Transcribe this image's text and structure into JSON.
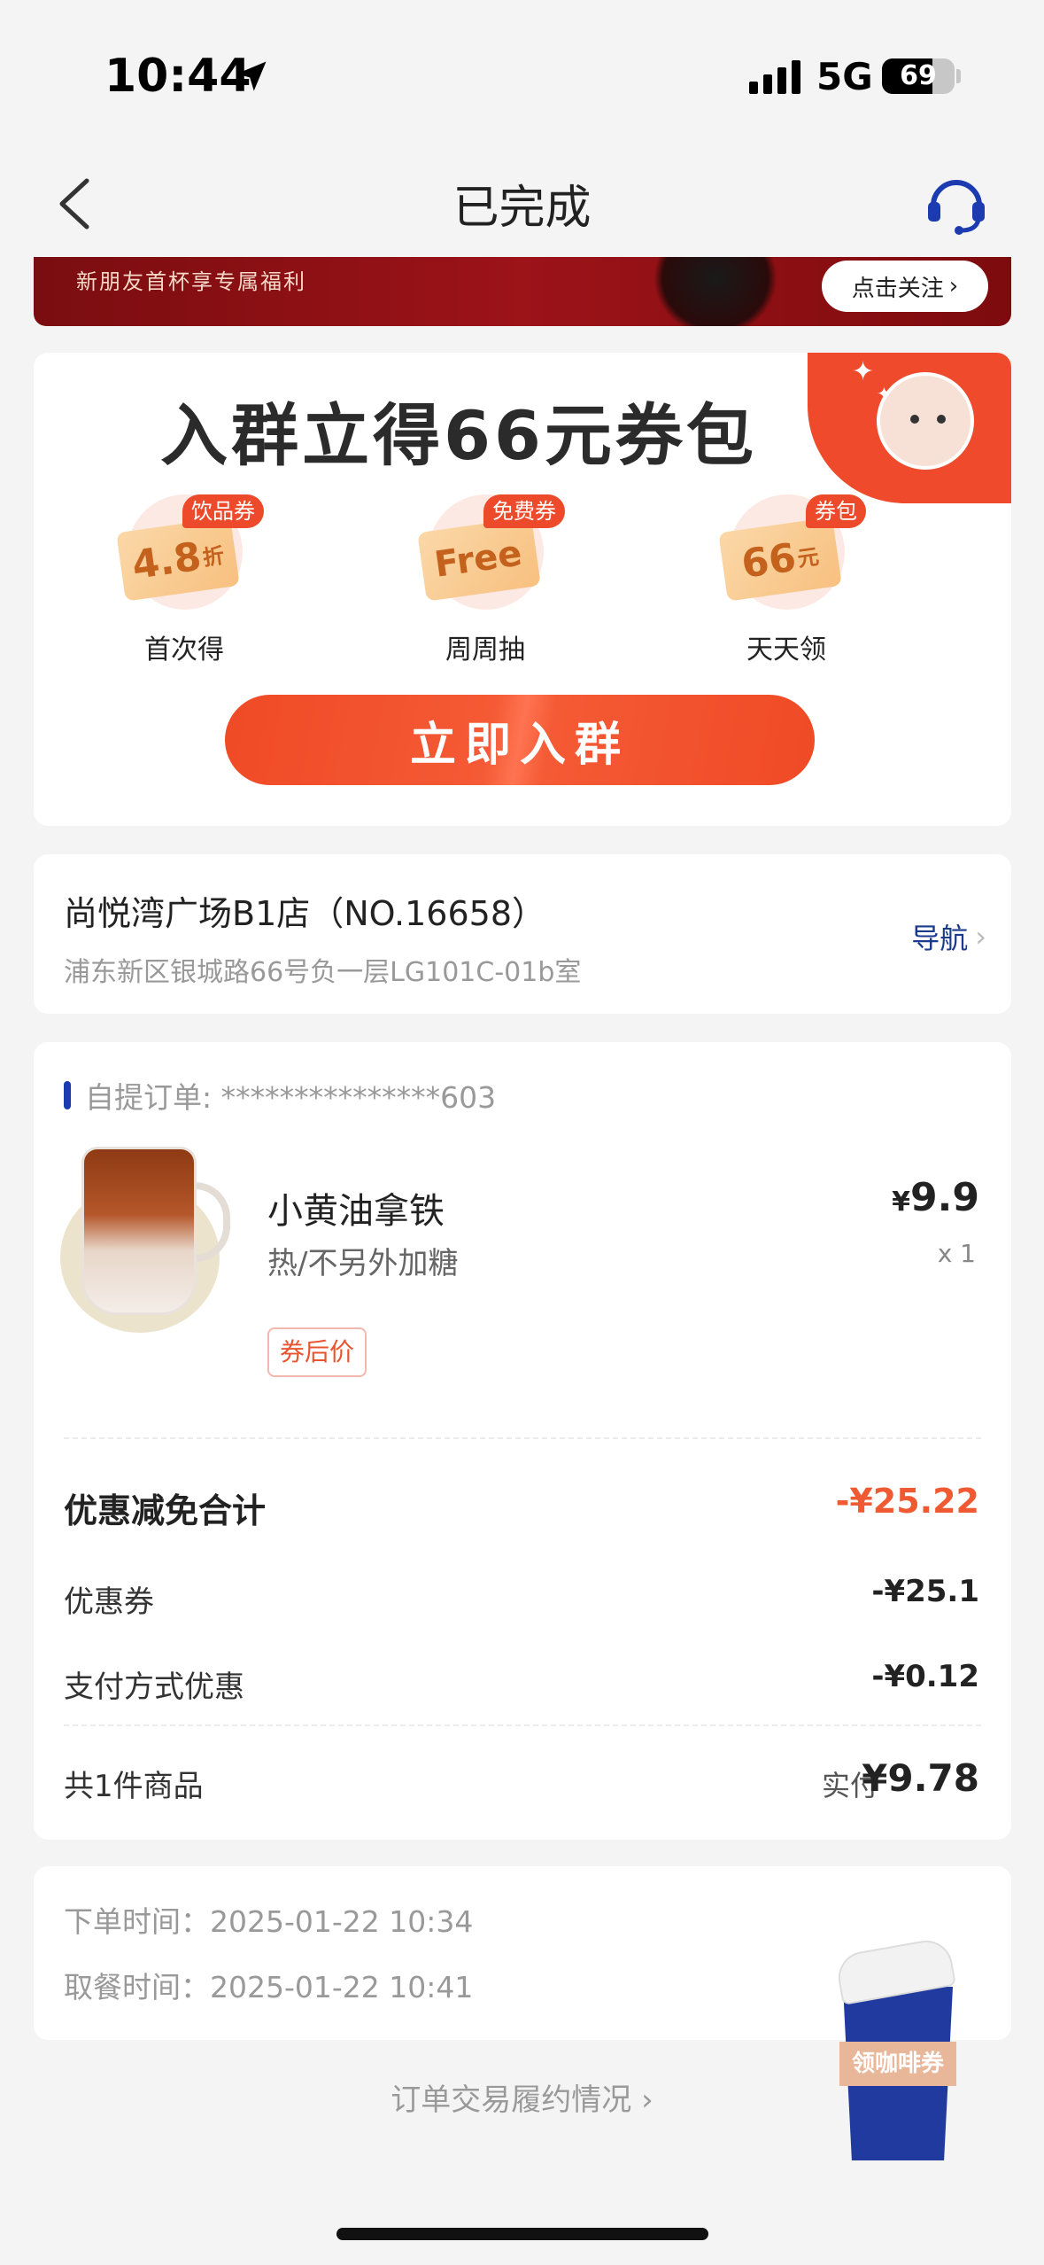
{
  "status_bar": {
    "time": "10:44",
    "network": "5G",
    "battery": "69"
  },
  "nav": {
    "title": "已完成"
  },
  "banner": {
    "text": "新朋友首杯享专属福利",
    "follow_label": "点击关注"
  },
  "promo": {
    "title": "入群立得66元券包",
    "coupons": [
      {
        "tag": "饮品券",
        "ticket_main": "4.8",
        "ticket_unit": "折",
        "label": "首次得"
      },
      {
        "tag": "免费券",
        "ticket_main": "Free",
        "ticket_unit": "",
        "label": "周周抽"
      },
      {
        "tag": "券包",
        "ticket_main": "66",
        "ticket_unit": "元",
        "label": "天天领"
      }
    ],
    "join_label": "立即入群"
  },
  "store": {
    "name": "尚悦湾广场B1店（NO.16658）",
    "address": "浦东新区银城路66号负一层LG101C-01b室",
    "nav_label": "导航"
  },
  "order": {
    "number_label": "自提订单: ***************603",
    "product": {
      "name": "小黄油拿铁",
      "spec": "热/不另外加糖",
      "price_currency": "¥",
      "price": "9.9",
      "quantity": "x 1",
      "coupon_tag": "券后价"
    },
    "discount_total_label": "优惠减免合计",
    "discount_total_value": "-¥25.22",
    "coupon_label": "优惠券",
    "coupon_value": "-¥25.1",
    "payment_label": "支付方式优惠",
    "payment_value": "-¥0.12",
    "count_label": "共1件商品",
    "paid_label": "实付",
    "paid_value": "¥9.78"
  },
  "times": {
    "order_time": "下单时间：2025-01-22 10:34",
    "pickup_time": "取餐时间：2025-01-22 10:41"
  },
  "fulfilment_link": "订单交易履约情况",
  "float_coupon": {
    "label": "领咖啡券"
  },
  "colors": {
    "accent": "#ef5a32",
    "brand_blue": "#1c3bb0",
    "background": "#f4f4f4"
  }
}
